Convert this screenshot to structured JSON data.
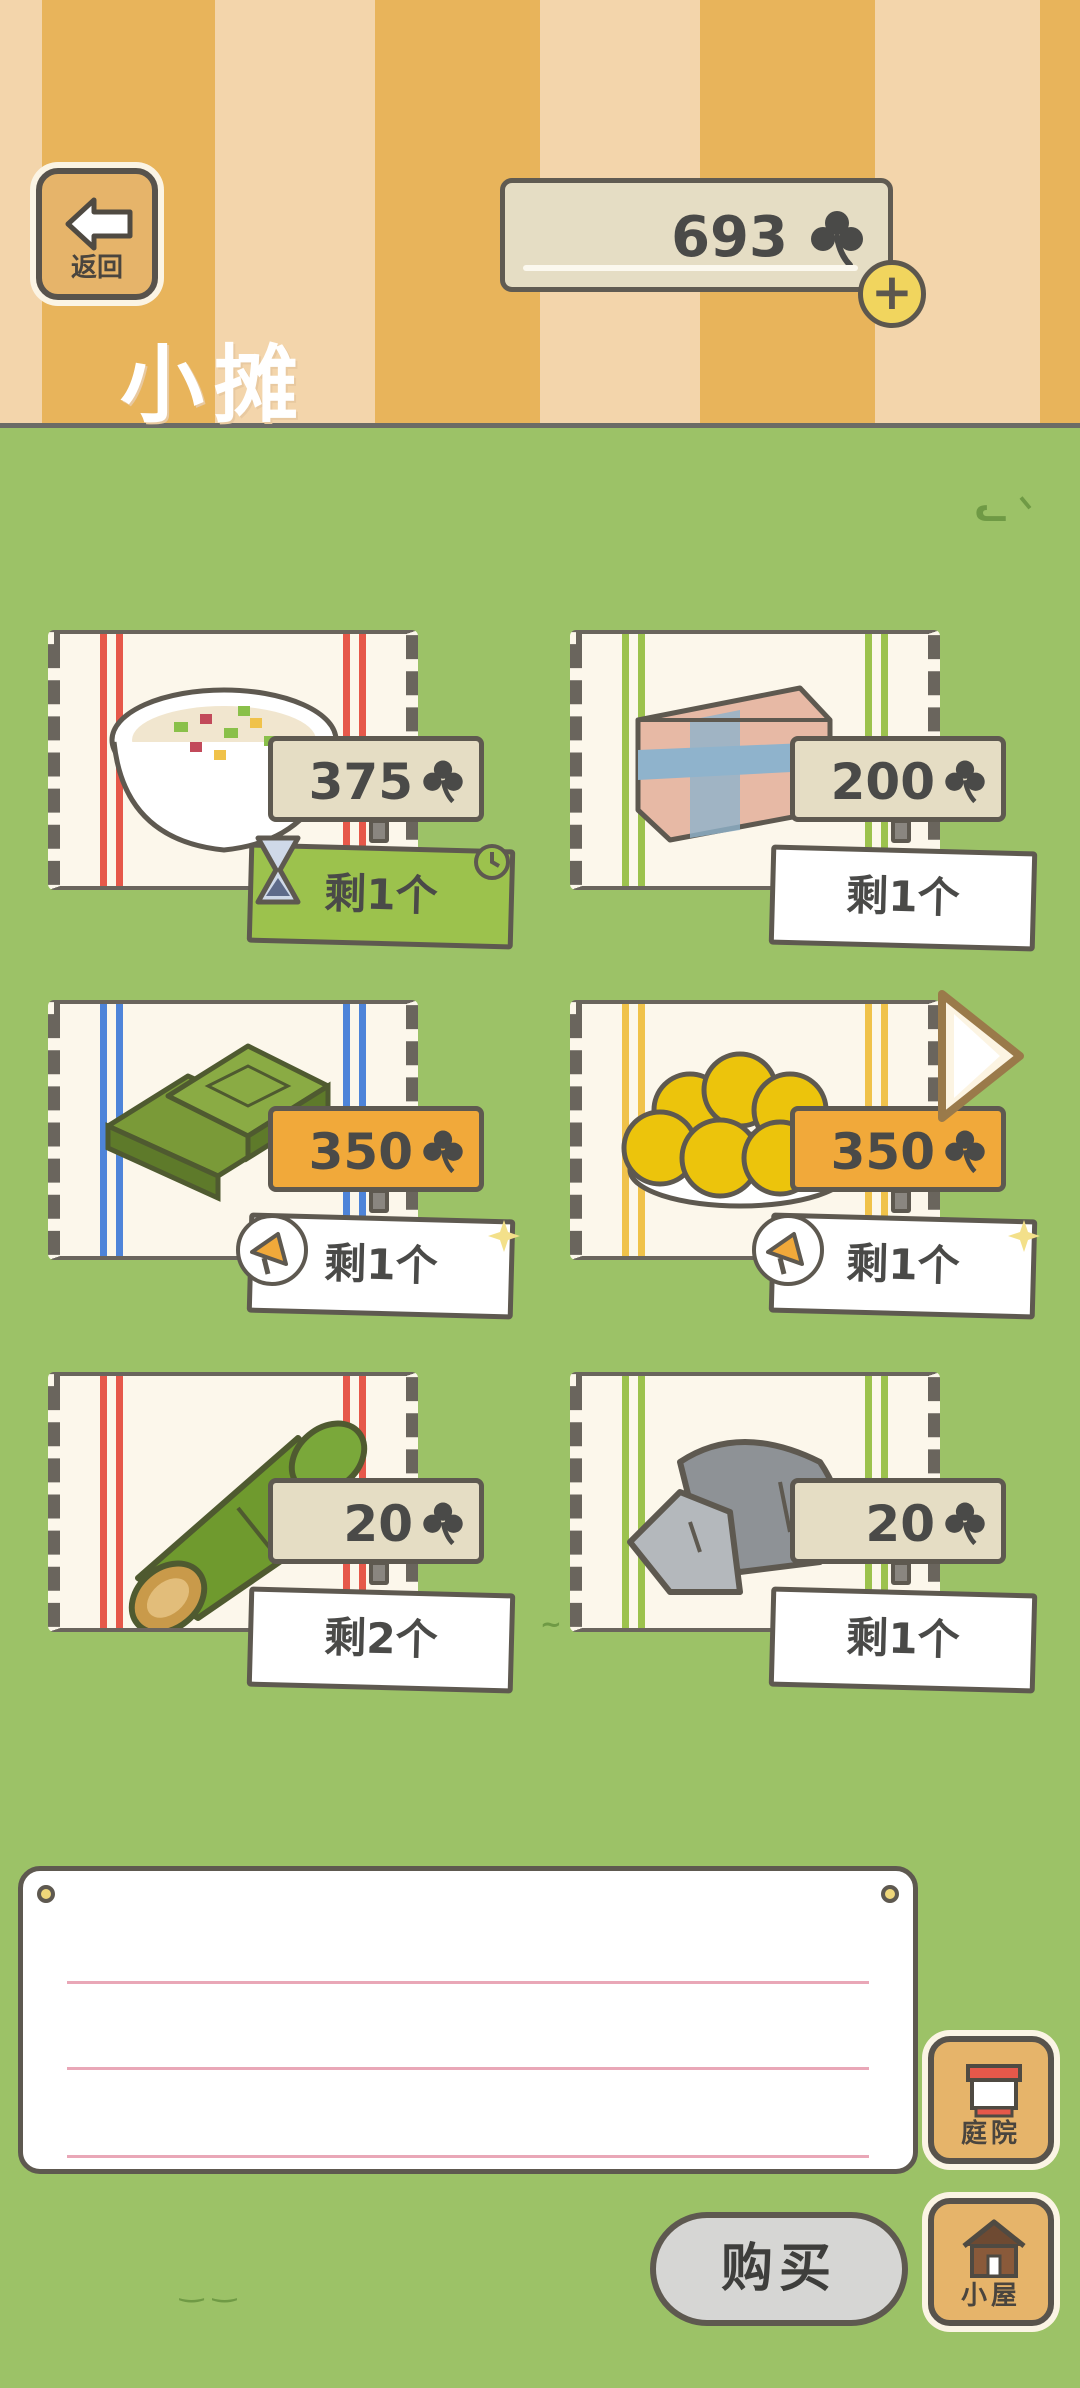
{
  "header": {
    "back_label": "返回",
    "title": "小摊",
    "currency": "693"
  },
  "items": [
    {
      "price": "375",
      "stock": "剩1个",
      "art": "rice-bowl",
      "stripe_color": "#e6584a",
      "tag_style": "timed"
    },
    {
      "price": "200",
      "stock": "剩1个",
      "art": "sandwich-cake",
      "stripe_color": "#9cc24d",
      "tag_style": "normal"
    },
    {
      "price": "350",
      "stock": "剩1个",
      "art": "matcha-bar",
      "stripe_color": "#4e84d9",
      "tag_style": "promo"
    },
    {
      "price": "350",
      "stock": "剩1个",
      "art": "yellow-dumplings",
      "stripe_color": "#f0c24a",
      "tag_style": "promo"
    },
    {
      "price": "20",
      "stock": "剩2个",
      "art": "bamboo",
      "stripe_color": "#e6584a",
      "tag_style": "normal"
    },
    {
      "price": "20",
      "stock": "剩1个",
      "art": "rock",
      "stripe_color": "#9cc24d",
      "tag_style": "normal"
    }
  ],
  "message": {
    "text": ""
  },
  "buttons": {
    "courtyard": "庭院",
    "house": "小屋",
    "buy": "购买"
  },
  "colors": {
    "grass": "#9cc267",
    "accent_orange": "#f1a93a",
    "accent_green": "#9cc24d"
  },
  "icons": [
    "back-arrow-icon",
    "clover-icon",
    "plus-icon",
    "hourglass-icon",
    "clock-icon",
    "megaphone-icon",
    "sparkle-icon",
    "next-arrow-icon",
    "courtyard-icon",
    "house-icon"
  ]
}
